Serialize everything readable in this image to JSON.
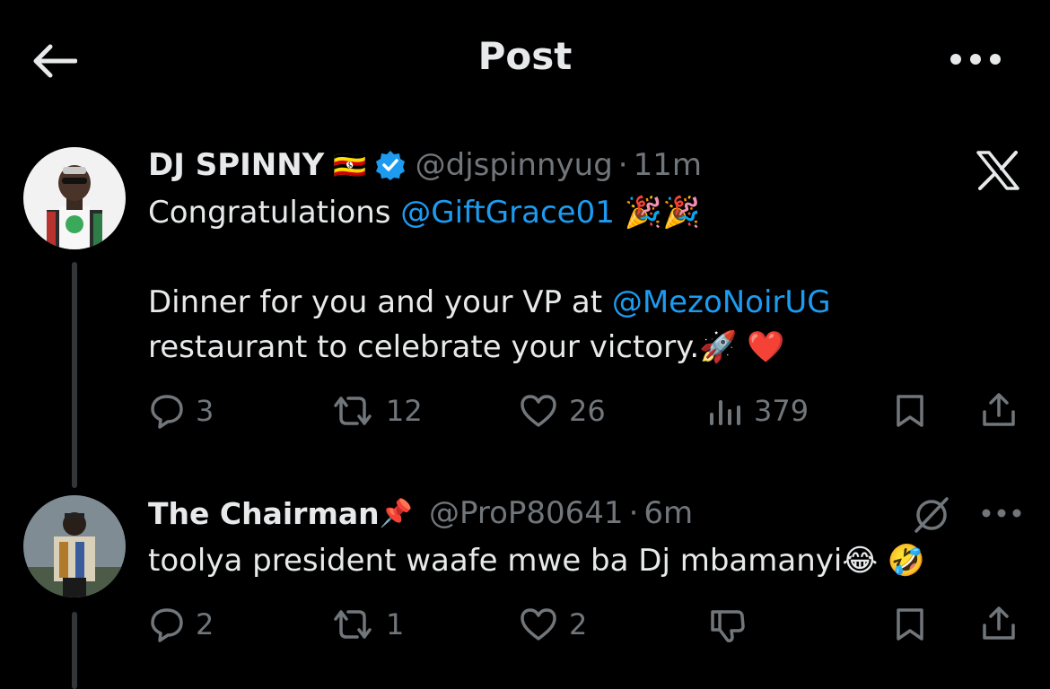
{
  "header": {
    "title": "Post"
  },
  "post": {
    "name": "DJ SPINNY",
    "flag": "🇺🇬",
    "handle": "@djspinnyug",
    "separator": "·",
    "time": "11m",
    "line1_text": "Congratulations ",
    "line1_mention": "@GiftGrace01",
    "line1_emoji": " 🎉🎉",
    "line2_text": "Dinner for you and your VP at ",
    "line2_mention": "@MezoNoirUG",
    "line3_text": "restaurant to celebrate your victory.🚀 ❤️",
    "replies": "3",
    "reposts": "12",
    "likes": "26",
    "views": "379"
  },
  "reply": {
    "name": "The Chairman",
    "pin_emoji": "📌",
    "handle": "@ProP80641",
    "separator": "·",
    "time": "6m",
    "text": "toolya president waafe mwe ba Dj mbamanyi😂 🤣",
    "replies": "2",
    "reposts": "1",
    "likes": "2"
  },
  "colors": {
    "background": "#000000",
    "text": "#e7e9ea",
    "muted": "#71767b",
    "accent": "#1d9bf0",
    "verified": "#1d9bf0"
  },
  "icons": {
    "back": "arrow-left-icon",
    "more": "more-horizontal-icon",
    "grok": "grok-x-icon",
    "reply": "reply-bubble-icon",
    "repost": "repost-icon",
    "like": "heart-icon",
    "views": "views-bar-icon",
    "bookmark": "bookmark-icon",
    "share": "share-icon",
    "dislike": "thumbs-down-icon",
    "mute": "slash-circle-icon"
  }
}
